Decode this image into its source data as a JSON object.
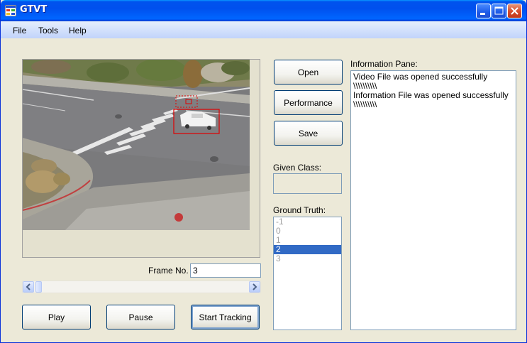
{
  "window": {
    "title": "GTVT"
  },
  "menu": {
    "items": [
      "File",
      "Tools",
      "Help"
    ]
  },
  "frame": {
    "label": "Frame No.",
    "value": "3"
  },
  "buttons": {
    "play": "Play",
    "pause": "Pause",
    "start_tracking": "Start Tracking",
    "open": "Open",
    "performance": "Performance",
    "save": "Save"
  },
  "given_class": {
    "label": "Given Class:",
    "value": ""
  },
  "ground_truth": {
    "label": "Ground Truth:",
    "options": [
      "-1",
      "0",
      "1",
      "2",
      "3"
    ],
    "selected": "2"
  },
  "info_pane": {
    "label": "Information Pane:",
    "lines": [
      "Video File was opened successfully",
      "\\\\\\\\\\\\\\\\\\\\",
      "Information File was opened successfully",
      "\\\\\\\\\\\\\\\\\\\\"
    ]
  },
  "colors": {
    "titlebar": "#0055e5",
    "selection": "#316ac5",
    "tracking_box": "#e00000"
  }
}
